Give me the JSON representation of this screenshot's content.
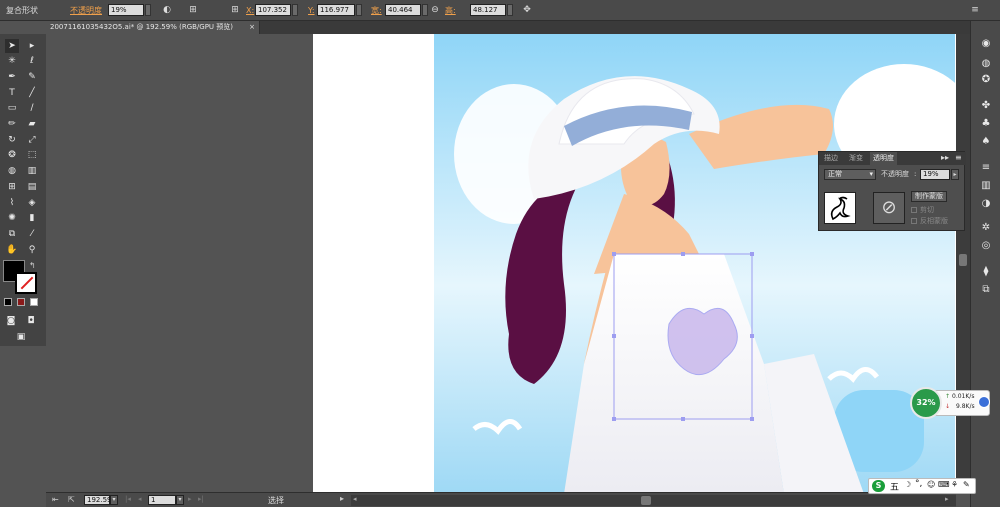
{
  "control_bar": {
    "object_type": "复合形状",
    "opacity_label": "不透明度",
    "opacity_value": "19%",
    "x_label": "X:",
    "x_value": "107.352",
    "y_label": "Y:",
    "y_value": "116.977",
    "w_label": "宽:",
    "w_value": "40.464",
    "h_label": "高:",
    "h_value": "48.127",
    "unit": "m"
  },
  "document_tab": {
    "title": "20071161035432O5.ai* @ 192.59% (RGB/GPU 预览)",
    "close": "×"
  },
  "toolbox": {
    "tools": [
      "selection",
      "direct-selection",
      "magic-wand",
      "lasso",
      "pen",
      "curvature",
      "type",
      "line",
      "rectangle",
      "paintbrush",
      "pencil",
      "eraser",
      "rotate",
      "scale",
      "warp",
      "free-transform",
      "shape-builder",
      "perspective",
      "mesh",
      "gradient",
      "eyedropper",
      "blend",
      "symbol-sprayer",
      "column-graph",
      "artboard",
      "slice",
      "hand",
      "zoom"
    ]
  },
  "transparency_panel": {
    "tabs": [
      "描边",
      "渐变",
      "透明度"
    ],
    "active_tab": "透明度",
    "blend_mode": "正常",
    "opacity_label": "不透明度",
    "opacity_value": "19%",
    "make_mask": "制作蒙版",
    "clip": "剪切",
    "invert_mask": "反相蒙版"
  },
  "status_bar": {
    "zoom": "192.59",
    "page": "1",
    "tool_name": "选择"
  },
  "net_monitor": {
    "percent": "32%",
    "upload": "0.01K/s",
    "download": "9.8K/s"
  },
  "ime_bar": {
    "logo": "S",
    "mode": "五"
  },
  "colors": {
    "ui_dark": "#535353",
    "panel": "#4a4a4a",
    "accent_orange": "#f0a04b",
    "sky": "#9ad9f5",
    "hair": "#5a0f43",
    "skin": "#f7c39a",
    "selection": "#9d9df0"
  }
}
